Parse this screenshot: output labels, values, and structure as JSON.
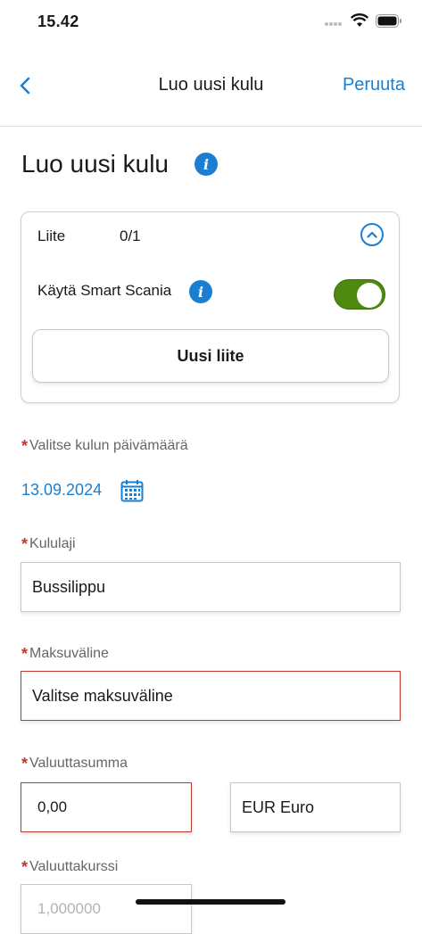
{
  "status_bar": {
    "time": "15.42",
    "icons": [
      "signal-dots-icon",
      "wifi-icon",
      "battery-icon"
    ]
  },
  "nav": {
    "back_icon": "chevron-left-icon",
    "title": "Luo uusi kulu",
    "cancel_label": "Peruuta"
  },
  "page": {
    "title": "Luo uusi kulu",
    "title_info_icon": "info-icon"
  },
  "attachment_card": {
    "label": "Liite",
    "count": "0/1",
    "collapse_icon": "chevron-up-icon",
    "smart_scan_label": "Käytä Smart Scania",
    "smart_scan_enabled": true,
    "new_attachment_button": "Uusi liite"
  },
  "form": {
    "date": {
      "required_mark": "*",
      "label": "Valitse kulun päivämäärä",
      "value": "13.09.2024",
      "icon": "calendar-icon"
    },
    "expense_type": {
      "required_mark": "*",
      "label": "Kululaji",
      "value": "Bussilippu"
    },
    "payment_method": {
      "required_mark": "*",
      "label": "Maksuväline",
      "value": "Valitse maksuväline",
      "error": true
    },
    "currency_amount": {
      "required_mark": "*",
      "label": "Valuuttasumma",
      "value": "0,00",
      "currency": "EUR Euro",
      "error": true
    },
    "exchange_rate": {
      "required_mark": "*",
      "label": "Valuuttakurssi",
      "value": "1,000000"
    }
  },
  "colors": {
    "accent": "#1a7fd1",
    "toggle_on": "#4f8a10",
    "error": "#c0392b"
  }
}
